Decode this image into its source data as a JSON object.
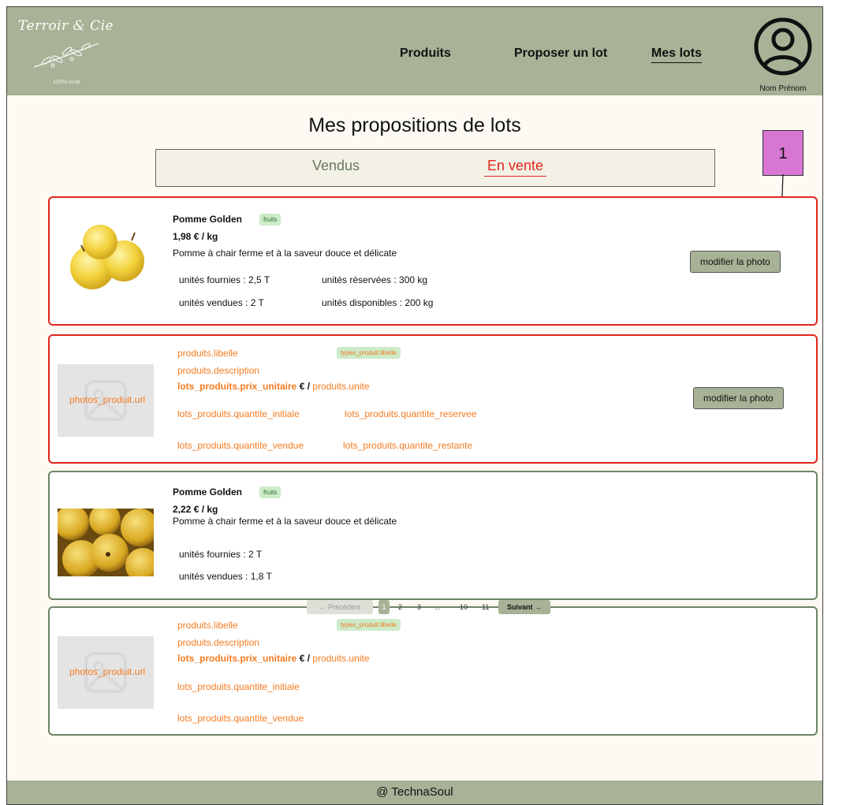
{
  "header": {
    "logo_title": "Terroir & Cie",
    "logo_sub": "100% local",
    "nav": [
      "Produits",
      "Proposer un lot",
      "Mes lots"
    ],
    "user_name": "Nom Prénom"
  },
  "page_title": "Mes propositions de lots",
  "tabs": {
    "sold": "Vendus",
    "on_sale": "En vente"
  },
  "annotation": "1",
  "cards": [
    {
      "name": "Pomme Golden",
      "tag": "fruits",
      "price": "1,98 € / kg",
      "desc": "Pomme à chair ferme et à la saveur douce et délicate",
      "provided": "unités fournies : 2,5 T",
      "reserved": "unités réservées : 300 kg",
      "sold": "unités vendues : 2 T",
      "available": "unités disponibles : 200 kg",
      "button": "modifier la photo"
    },
    {
      "name": "produits.libelle",
      "tag": "types_produit.libelle",
      "desc": "produits.description",
      "price_field": "lots_produits.prix_unitaire",
      "euro_sep": "€ /",
      "unit_field": "produits.unite",
      "photo": "photos_produit.url",
      "qty_initial": "lots_produits.quantite_initiale",
      "qty_reserved": "lots_produits.quantite_reservee",
      "qty_sold": "lots_produits.quantite_vendue",
      "qty_remaining": "lots_produits.quantite_restante",
      "button": "modifier la photo"
    },
    {
      "name": "Pomme Golden",
      "tag": "fruits",
      "price": "2,22 € / kg",
      "desc": "Pomme à chair ferme et à la saveur douce et délicate",
      "provided": "unités fournies : 2 T",
      "sold": "unités vendues : 1,8 T"
    },
    {
      "name": "produits.libelle",
      "tag": "types_produit.libelle",
      "desc": "produits.description",
      "price_field": "lots_produits.prix_unitaire",
      "euro_sep": "€ /",
      "unit_field": "produits.unite",
      "photo": "photos_produit.url",
      "qty_initial": "lots_produits.quantite_initiale",
      "qty_sold": "lots_produits.quantite_vendue"
    }
  ],
  "pagination": {
    "prev": "← Précédent",
    "pages": [
      "1",
      "2",
      "3",
      "...",
      "10",
      "11"
    ],
    "next": "Suivant →"
  },
  "footer": "@ TechnaSoul"
}
